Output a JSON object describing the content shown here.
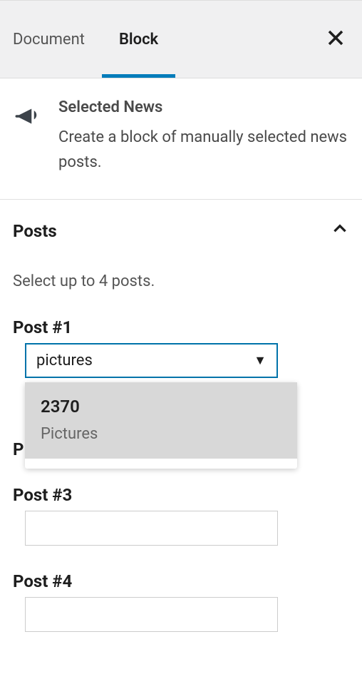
{
  "tabs": {
    "document": "Document",
    "block": "Block"
  },
  "block_info": {
    "title": "Selected News",
    "description": "Create a block of manually selected news posts."
  },
  "panel": {
    "title": "Posts",
    "hint": "Select up to 4 posts."
  },
  "posts": {
    "p1": {
      "label": "Post #1",
      "value": "pictures"
    },
    "p2": {
      "label": "Post #2",
      "value": ""
    },
    "p3": {
      "label": "Post #3",
      "value": ""
    },
    "p4": {
      "label": "Post #4",
      "value": ""
    }
  },
  "dropdown": {
    "option_id": "2370",
    "option_label": "Pictures"
  },
  "hidden_p2_prefix": "P"
}
